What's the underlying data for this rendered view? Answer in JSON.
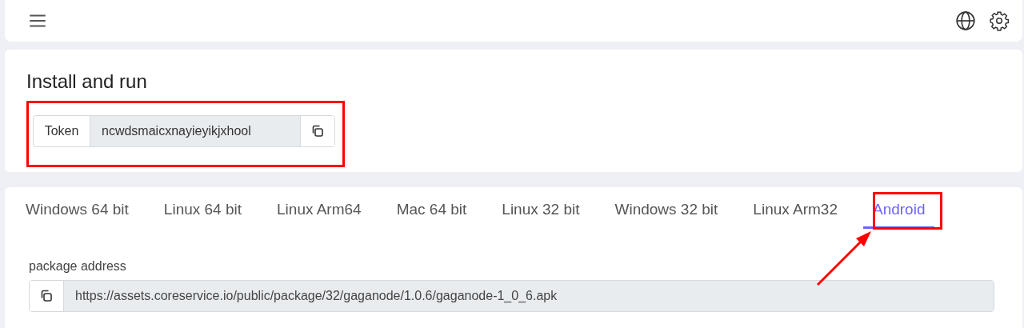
{
  "install": {
    "title": "Install and run",
    "token": {
      "label": "Token",
      "value": "ncwdsmaicxnayieyikjxhool"
    }
  },
  "tabs": [
    {
      "label": "Windows 64 bit",
      "selected": false
    },
    {
      "label": "Linux 64 bit",
      "selected": false
    },
    {
      "label": "Linux Arm64",
      "selected": false
    },
    {
      "label": "Mac 64 bit",
      "selected": false
    },
    {
      "label": "Linux 32 bit",
      "selected": false
    },
    {
      "label": "Windows 32 bit",
      "selected": false
    },
    {
      "label": "Linux Arm32",
      "selected": false
    },
    {
      "label": "Android",
      "selected": true
    }
  ],
  "package": {
    "label": "package address",
    "value": "https://assets.coreservice.io/public/package/32/gaganode/1.0.6/gaganode-1_0_6.apk"
  }
}
